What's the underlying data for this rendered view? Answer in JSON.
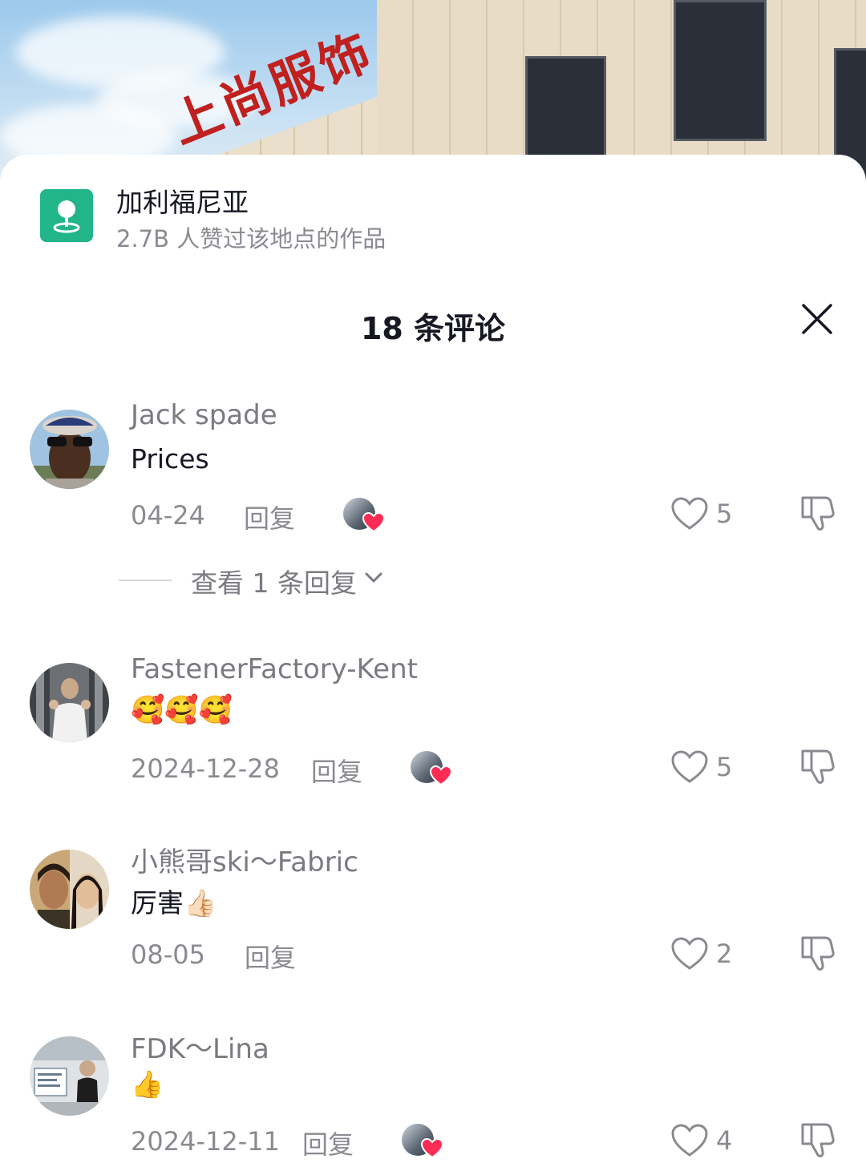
{
  "location": {
    "name": "加利福尼亚",
    "subtitle": "2.7B 人赞过该地点的作品",
    "icon": "location-pin-icon"
  },
  "sheet_title": "18 条评论",
  "background_sign_text": "上尚服饰",
  "comments": [
    {
      "username": "Jack spade",
      "text": "Prices",
      "date": "04-24",
      "reply_label": "回复",
      "likes": "5",
      "has_author_like": true,
      "view_replies": "查看 1 条回复"
    },
    {
      "username": "FastenerFactory-Kent",
      "text": "🥰🥰🥰",
      "date": "2024-12-28",
      "reply_label": "回复",
      "likes": "5",
      "has_author_like": true
    },
    {
      "username": "小熊哥ski～Fabric",
      "text": "厉害👍🏻",
      "date": "08-05",
      "reply_label": "回复",
      "likes": "2",
      "has_author_like": false
    },
    {
      "username": "FDK～Lina",
      "text": "👍",
      "date": "2024-12-11",
      "reply_label": "回复",
      "likes": "4",
      "has_author_like": true
    }
  ],
  "colors": {
    "accent_green": "#22b58a",
    "heart_red": "#fe2c55",
    "muted_text": "#8a8b91"
  }
}
